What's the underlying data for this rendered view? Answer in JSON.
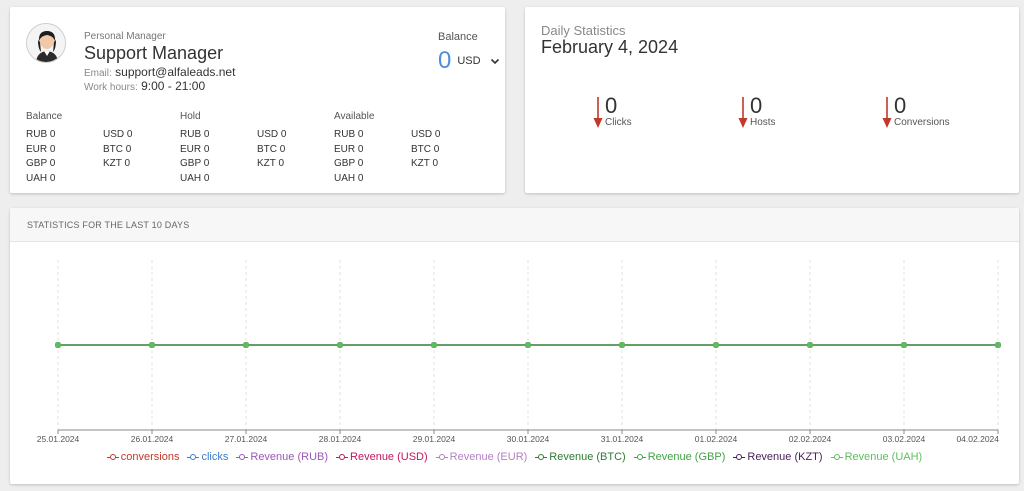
{
  "manager": {
    "label": "Personal Manager",
    "name": "Support Manager",
    "email_label": "Email:",
    "email": "support@alfaleads.net",
    "hours_label": "Work hours:",
    "hours": "9:00 - 21:00",
    "avatar_icon": "avatar-icon"
  },
  "balance": {
    "label": "Balance",
    "value": "0",
    "currency": "USD",
    "accent": "#4a90d9"
  },
  "groups": [
    {
      "title": "Balance",
      "col1": [
        "RUB 0",
        "EUR 0",
        "GBP 0",
        "UAH 0"
      ],
      "col2": [
        "USD 0",
        "BTC 0",
        "KZT 0"
      ]
    },
    {
      "title": "Hold",
      "col1": [
        "RUB 0",
        "EUR 0",
        "GBP 0",
        "UAH 0"
      ],
      "col2": [
        "USD 0",
        "BTC 0",
        "KZT 0"
      ]
    },
    {
      "title": "Available",
      "col1": [
        "RUB 0",
        "EUR 0",
        "GBP 0",
        "UAH 0"
      ],
      "col2": [
        "USD 0",
        "BTC 0",
        "KZT 0"
      ]
    }
  ],
  "daily": {
    "title": "Daily Statistics",
    "date": "February 4, 2024",
    "stats": [
      {
        "value": "0",
        "label": "Clicks",
        "icon": "arrow-down-icon",
        "color": "#c0392b"
      },
      {
        "value": "0",
        "label": "Hosts",
        "icon": "arrow-down-icon",
        "color": "#c0392b"
      },
      {
        "value": "0",
        "label": "Conversions",
        "icon": "arrow-down-icon",
        "color": "#c0392b"
      }
    ]
  },
  "chart_section": {
    "title": "STATISTICS FOR THE LAST 10 DAYS"
  },
  "chart_data": {
    "type": "line",
    "x": [
      "25.01.2024",
      "26.01.2024",
      "27.01.2024",
      "28.01.2024",
      "29.01.2024",
      "30.01.2024",
      "31.01.2024",
      "01.02.2024",
      "02.02.2024",
      "03.02.2024",
      "04.02.2024"
    ],
    "series": [
      {
        "name": "conversions",
        "color": "#c0392b",
        "values": [
          0,
          0,
          0,
          0,
          0,
          0,
          0,
          0,
          0,
          0,
          0
        ]
      },
      {
        "name": "clicks",
        "color": "#3d7ec9",
        "values": [
          0,
          0,
          0,
          0,
          0,
          0,
          0,
          0,
          0,
          0,
          0
        ]
      },
      {
        "name": "Revenue (RUB)",
        "color": "#9b59b6",
        "values": [
          0,
          0,
          0,
          0,
          0,
          0,
          0,
          0,
          0,
          0,
          0
        ]
      },
      {
        "name": "Revenue (USD)",
        "color": "#c2185b",
        "values": [
          0,
          0,
          0,
          0,
          0,
          0,
          0,
          0,
          0,
          0,
          0
        ]
      },
      {
        "name": "Revenue (EUR)",
        "color": "#b37fc4",
        "values": [
          0,
          0,
          0,
          0,
          0,
          0,
          0,
          0,
          0,
          0,
          0
        ]
      },
      {
        "name": "Revenue (BTC)",
        "color": "#2e7d32",
        "values": [
          0,
          0,
          0,
          0,
          0,
          0,
          0,
          0,
          0,
          0,
          0
        ]
      },
      {
        "name": "Revenue (GBP)",
        "color": "#43a047",
        "values": [
          0,
          0,
          0,
          0,
          0,
          0,
          0,
          0,
          0,
          0,
          0
        ]
      },
      {
        "name": "Revenue (KZT)",
        "color": "#4a235a",
        "values": [
          0,
          0,
          0,
          0,
          0,
          0,
          0,
          0,
          0,
          0,
          0
        ]
      },
      {
        "name": "Revenue (UAH)",
        "color": "#5cbf5c",
        "values": [
          0,
          0,
          0,
          0,
          0,
          0,
          0,
          0,
          0,
          0,
          0
        ]
      }
    ],
    "grid": true,
    "legend": "bottom"
  }
}
